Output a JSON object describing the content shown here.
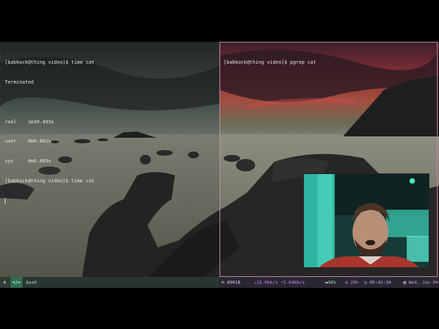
{
  "terminals": {
    "left": {
      "lines": [
        "[babkock@thing video]$ time cat",
        "Terminated",
        "",
        "real    1m39.493s",
        "user    0m0.001s",
        "sys     0m0.003s",
        "[babkock@thing video]$ time cat"
      ]
    },
    "right": {
      "lines": [
        "[babkock@thing video]$ pgrep cat"
      ]
    }
  },
  "statusbar": {
    "workspace": "⊕",
    "app_icon": "</>",
    "window_title": "bash",
    "memory": "⊟ 8901B",
    "network": "⇣15.9kb/s ⇡5.64kb/s",
    "battery": "▬96%",
    "cpu": "◔ 29%",
    "time": "◷ 05:42:30",
    "date": "▦ Wed, Jan 04"
  },
  "colors": {
    "pane_border_active": "#c98aa4",
    "statusbar_bg": "#2c2833",
    "accent_green": "#2f6d50"
  }
}
